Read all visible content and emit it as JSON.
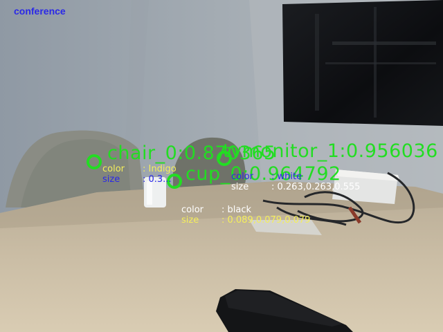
{
  "scene_label": "conference",
  "overlay_color": "#22dd22",
  "detections": [
    {
      "label": "chair_0:0.870365",
      "attributes": {
        "color_key": "color",
        "color_value": ": Indigo",
        "size_key": "size",
        "size_value": ": 0.3..."
      }
    },
    {
      "label": "tvmonitor_1:0.956036",
      "attributes": {
        "color_key": "color",
        "color_value": ": white",
        "size_key": "size",
        "size_value": ": 0.263,0.263,0.555"
      }
    },
    {
      "label": "cup_0:0.964792",
      "attributes": {
        "color_key": "color",
        "color_value": ": black",
        "size_key": "size",
        "size_value": ": 0.089,0.079,0.079"
      }
    }
  ],
  "attribute_colors": {
    "chair_color": "#f5ef5a",
    "chair_size": "#2a28e8",
    "tv_color": "#2a28e8",
    "tv_size": "#ffffff",
    "cup_color": "#ffffff",
    "cup_size": "#f5ef5a"
  }
}
